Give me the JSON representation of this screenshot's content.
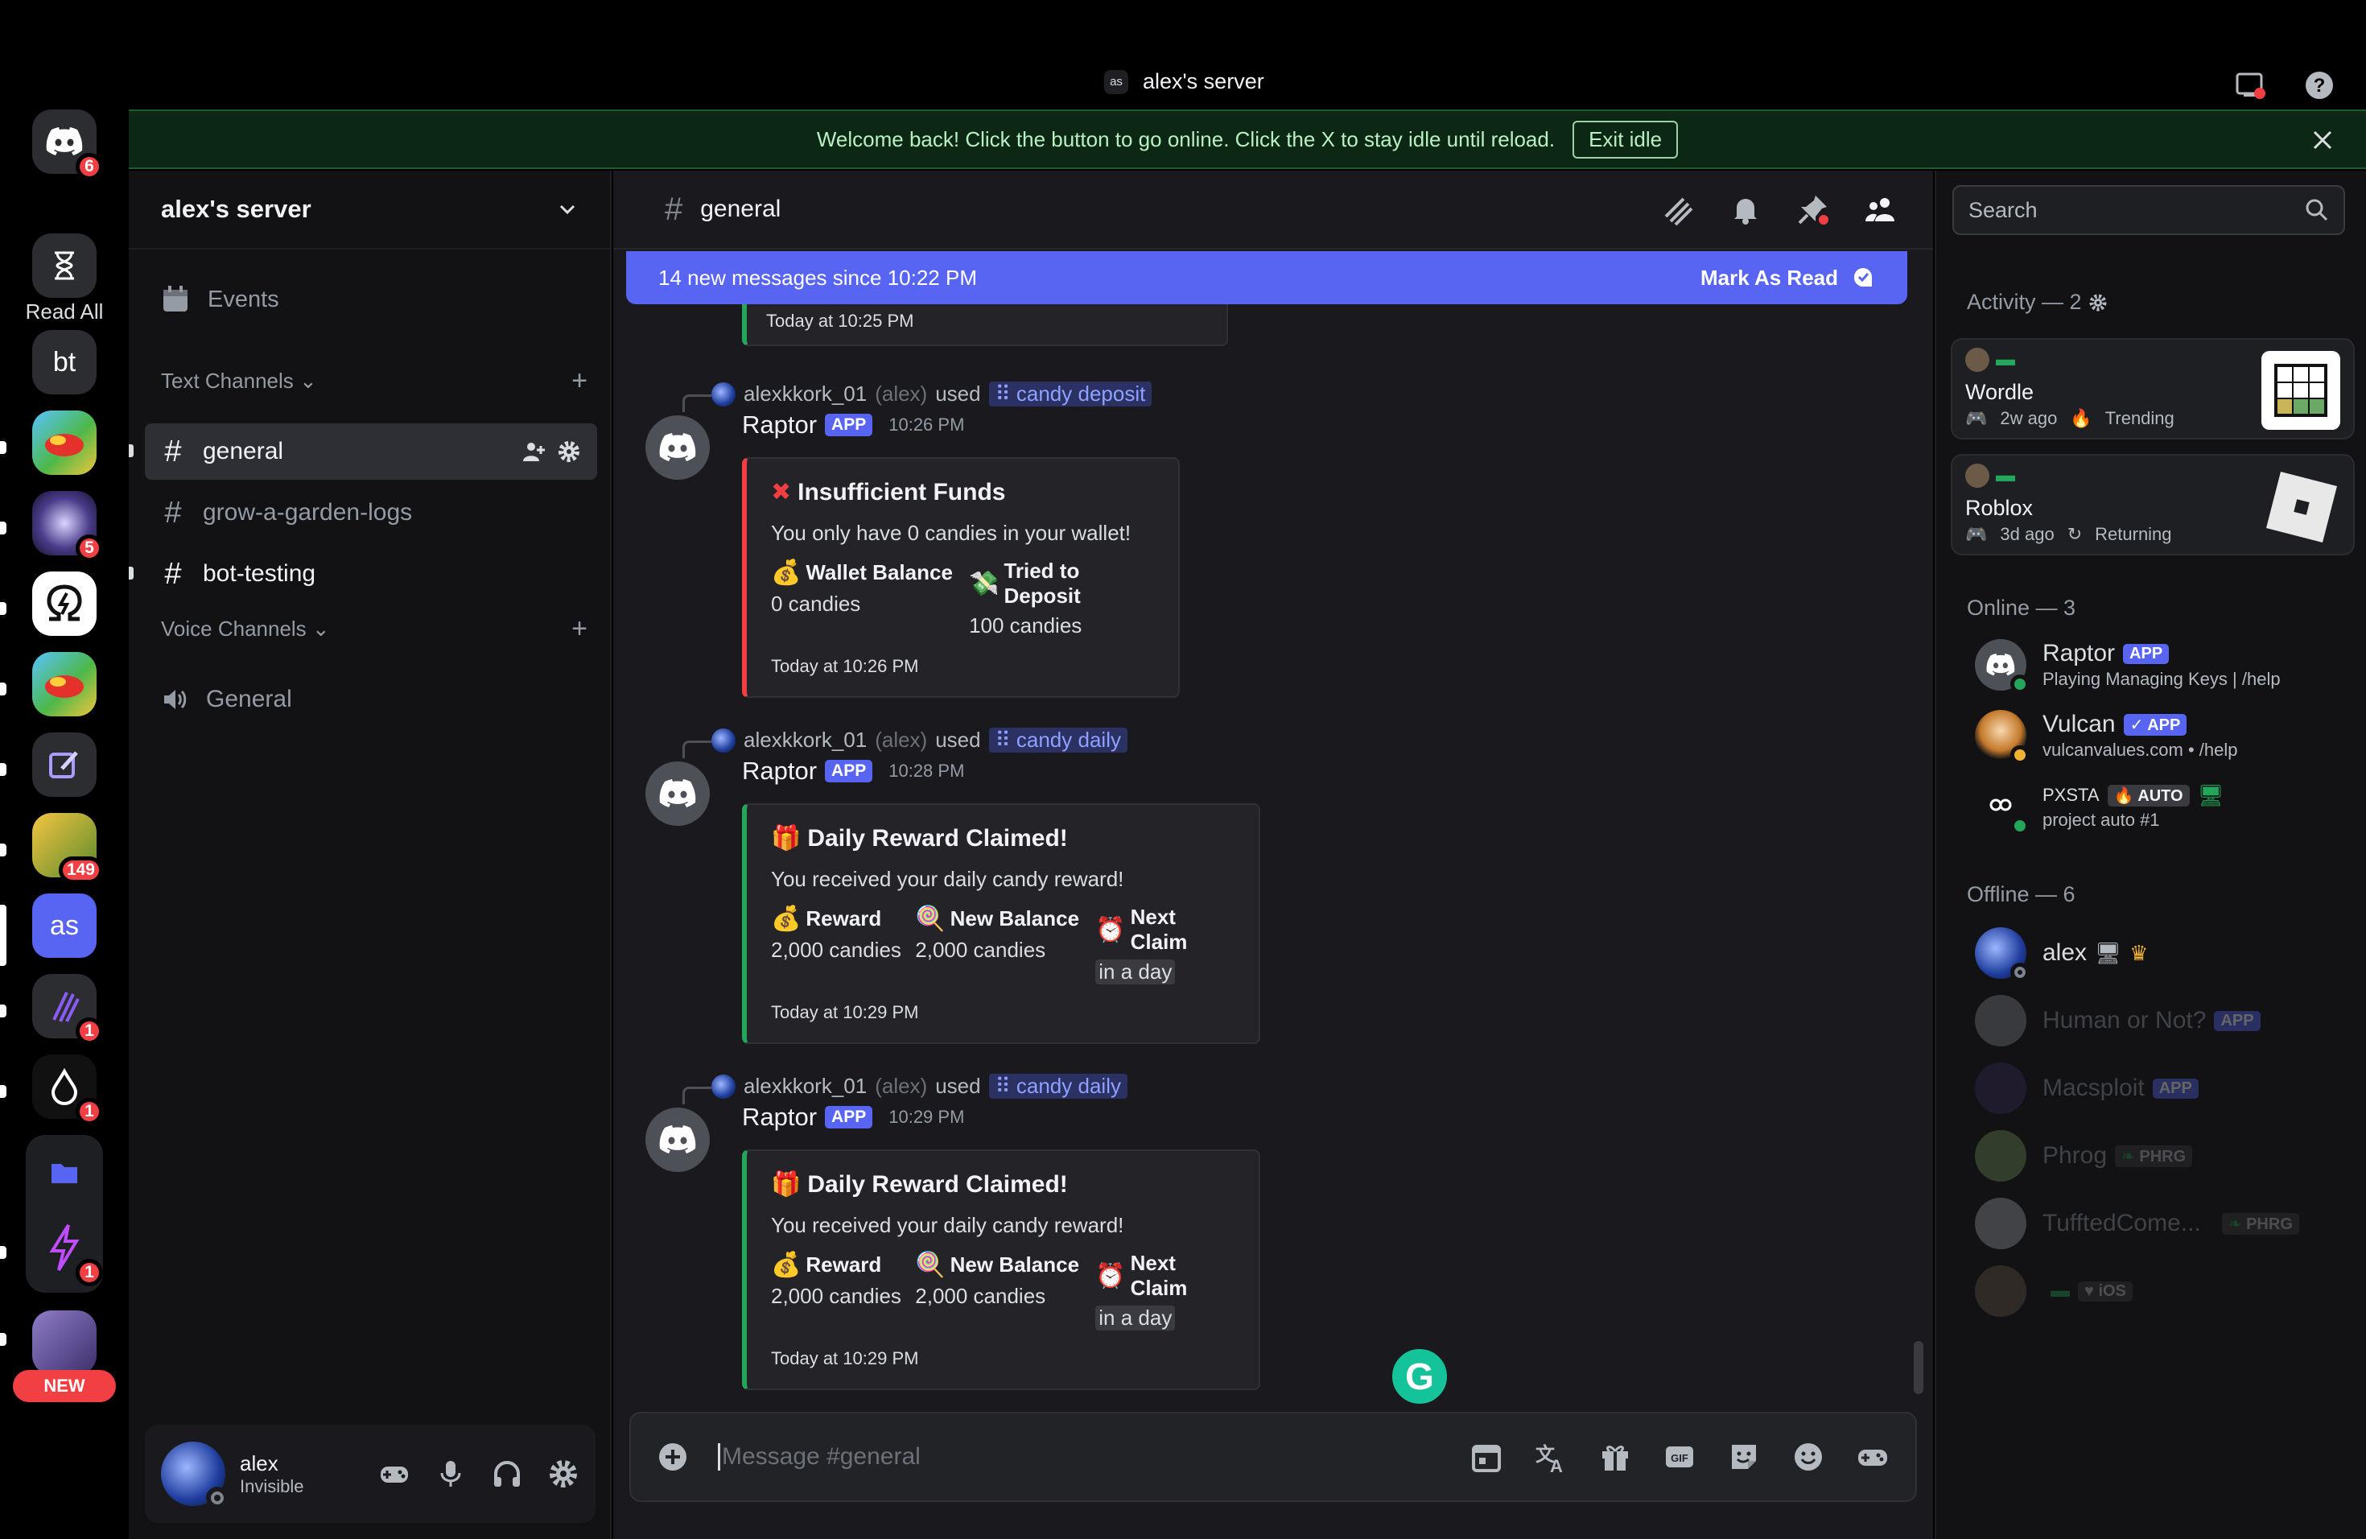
{
  "window": {
    "server_tag": "as",
    "title": "alex's server"
  },
  "banner": {
    "text": "Welcome back! Click the button to go online. Click the X to stay idle until reload.",
    "button": "Exit idle"
  },
  "rail": {
    "read_all": "Read All",
    "home_badge": "6",
    "servers": [
      {
        "label": "bt"
      },
      {
        "badge": "5"
      },
      {
        "badge": "149"
      },
      {
        "label": "as"
      },
      {
        "badge": "1"
      },
      {
        "badge": "1"
      },
      {
        "badge": "1"
      }
    ],
    "new_label": "NEW"
  },
  "sidebar": {
    "server_name": "alex's server",
    "events": "Events",
    "text_category": "Text Channels",
    "text_channels": [
      "general",
      "grow-a-garden-logs",
      "bot-testing"
    ],
    "voice_category": "Voice Channels",
    "voice_channels": [
      "General"
    ],
    "user": {
      "name": "alex",
      "status": "Invisible"
    }
  },
  "chat": {
    "channel": "general",
    "new_messages": "14 new messages since 10:22 PM",
    "mark_as_read": "Mark As Read",
    "partial_footer": "Today at 10:25 PM",
    "placeholder": "Message #general",
    "messages": [
      {
        "user": "alexkkork_01",
        "alias": "(alex)",
        "used": "used",
        "command": "candy deposit",
        "bot": "Raptor",
        "tag": "APP",
        "time": "10:26 PM",
        "embed": {
          "title": "Insufficient Funds",
          "desc": "You only have 0 candies in your wallet!",
          "fields": [
            {
              "name": "Wallet Balance",
              "value": "0 candies"
            },
            {
              "name": "Tried to Deposit",
              "value": "100 candies"
            }
          ],
          "footer": "Today at 10:26 PM"
        }
      },
      {
        "user": "alexkkork_01",
        "alias": "(alex)",
        "used": "used",
        "command": "candy daily",
        "bot": "Raptor",
        "tag": "APP",
        "time": "10:28 PM",
        "embed": {
          "title": "Daily Reward Claimed!",
          "desc": "You received your daily candy reward!",
          "fields": [
            {
              "name": "Reward",
              "value": "2,000 candies"
            },
            {
              "name": "New Balance",
              "value": "2,000 candies"
            },
            {
              "name": "Next Claim",
              "value": "in a day"
            }
          ],
          "footer": "Today at 10:29 PM"
        }
      },
      {
        "user": "alexkkork_01",
        "alias": "(alex)",
        "used": "used",
        "command": "candy daily",
        "bot": "Raptor",
        "tag": "APP",
        "time": "10:29 PM",
        "embed": {
          "title": "Daily Reward Claimed!",
          "desc": "You received your daily candy reward!",
          "fields": [
            {
              "name": "Reward",
              "value": "2,000 candies"
            },
            {
              "name": "New Balance",
              "value": "2,000 candies"
            },
            {
              "name": "Next Claim",
              "value": "in a day"
            }
          ],
          "footer": "Today at 10:29 PM"
        }
      }
    ]
  },
  "right": {
    "search_placeholder": "Search",
    "activity_header": "Activity — 2",
    "activities": [
      {
        "name": "Wordle",
        "ago": "2w ago",
        "status": "Trending"
      },
      {
        "name": "Roblox",
        "ago": "3d ago",
        "status": "Returning"
      }
    ],
    "online_header": "Online — 3",
    "online": [
      {
        "name": "Raptor",
        "tag": "APP",
        "status": "Playing Managing Keys | /help"
      },
      {
        "name": "Vulcan",
        "tag": "APP",
        "status": "vulcanvalues.com • /help"
      },
      {
        "name": "PXSTA",
        "tag": "AUTO",
        "status": "project auto #1"
      }
    ],
    "offline_header": "Offline — 6",
    "offline": [
      {
        "name": "alex"
      },
      {
        "name": "Human or Not?",
        "tag": "APP"
      },
      {
        "name": "Macsploit",
        "tag": "APP"
      },
      {
        "name": "Phrog",
        "tag": "PHRG"
      },
      {
        "name": "TufftedCome...",
        "tag": "PHRG"
      },
      {
        "name": "",
        "tag": "iOS"
      }
    ]
  }
}
